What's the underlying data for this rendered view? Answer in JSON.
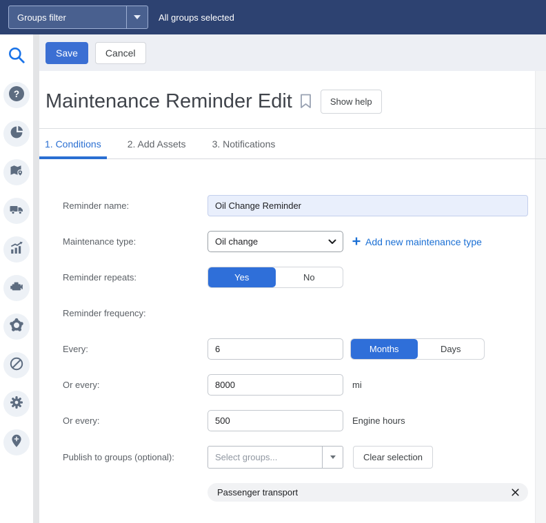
{
  "topbar": {
    "groups_filter_label": "Groups filter",
    "status": "All groups selected"
  },
  "colors": {
    "topbar_bg": "#2d4271",
    "primary_button": "#3b6fd3",
    "toggle_selected": "#2f6fd9",
    "active_tab": "#2a6fd2",
    "link": "#1a6fd4",
    "name_input_bg": "#e9effc"
  },
  "sidebar": {
    "icons": [
      "search-icon",
      "help-icon",
      "pie-chart-icon",
      "map-icon",
      "truck-icon",
      "chart-icon",
      "engine-icon",
      "hub-gear-icon",
      "no-entry-icon",
      "gear-icon",
      "location-pin-icon"
    ]
  },
  "toolbar": {
    "save_label": "Save",
    "cancel_label": "Cancel"
  },
  "page": {
    "title": "Maintenance Reminder Edit",
    "show_help_label": "Show help"
  },
  "tabs": [
    {
      "label": "1. Conditions",
      "active": true
    },
    {
      "label": "2. Add Assets",
      "active": false
    },
    {
      "label": "3. Notifications",
      "active": false
    }
  ],
  "form": {
    "reminder_name": {
      "label": "Reminder name:",
      "value": "Oil Change Reminder"
    },
    "maintenance_type": {
      "label": "Maintenance type:",
      "value": "Oil change",
      "add_link_label": "Add new maintenance type"
    },
    "reminder_repeats": {
      "label": "Reminder repeats:",
      "options": [
        "Yes",
        "No"
      ],
      "selected": "Yes"
    },
    "reminder_frequency": {
      "label": "Reminder frequency:"
    },
    "every": {
      "label": "Every:",
      "value": "6",
      "options": [
        "Months",
        "Days"
      ],
      "selected": "Months"
    },
    "or_every_distance": {
      "label": "Or every:",
      "value": "8000",
      "unit": "mi"
    },
    "or_every_hours": {
      "label": "Or every:",
      "value": "500",
      "unit": "Engine hours"
    },
    "publish_groups": {
      "label": "Publish to groups (optional):",
      "placeholder": "Select groups...",
      "clear_label": "Clear selection"
    },
    "selected_group_chip": {
      "label": "Passenger transport"
    }
  }
}
